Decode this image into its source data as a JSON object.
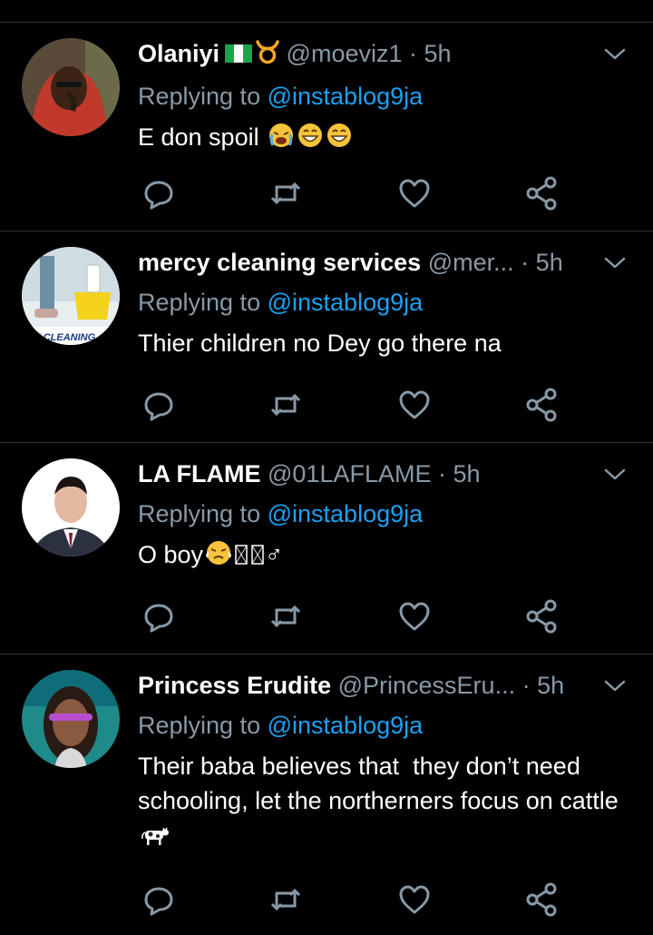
{
  "colors": {
    "background": "#000000",
    "divider": "#2f3336",
    "secondary_text": "#8899a6",
    "link": "#1da1f2"
  },
  "tweets": [
    {
      "name": "Olaniyi",
      "handle": "@moeviz1",
      "separator": "·",
      "time": "5h",
      "reply_prefix": "Replying to",
      "reply_handle": "@instablog9ja",
      "text": "E don spoil",
      "emojis": [
        "nigeria-flag",
        "taurus",
        "crying-face",
        "grinning-face",
        "grinning-face"
      ]
    },
    {
      "name": "mercy cleaning services",
      "handle": "@mer...",
      "separator": "·",
      "time": "5h",
      "reply_prefix": "Replying to",
      "reply_handle": "@instablog9ja",
      "text": "Thier children no Dey go there na",
      "avatar_text": "SE CLEANING"
    },
    {
      "name": "LA FLAME",
      "handle": "@01LAFLAME",
      "separator": "·",
      "time": "5h",
      "reply_prefix": "Replying to",
      "reply_handle": "@instablog9ja",
      "text": "O boy",
      "trailing_text": "♂",
      "emojis": [
        "triumph-face",
        "missing-glyph",
        "missing-glyph"
      ]
    },
    {
      "name": "Princess Erudite",
      "handle": "@PrincessEru...",
      "separator": "·",
      "time": "5h",
      "reply_prefix": "Replying to",
      "reply_handle": "@instablog9ja",
      "text": "Their baba believes that  they don’t need schooling, let the northerners focus on cattle",
      "emojis": [
        "cow"
      ]
    }
  ],
  "icons": [
    "reply-icon",
    "retweet-icon",
    "like-icon",
    "share-icon",
    "chevron-down-icon"
  ]
}
